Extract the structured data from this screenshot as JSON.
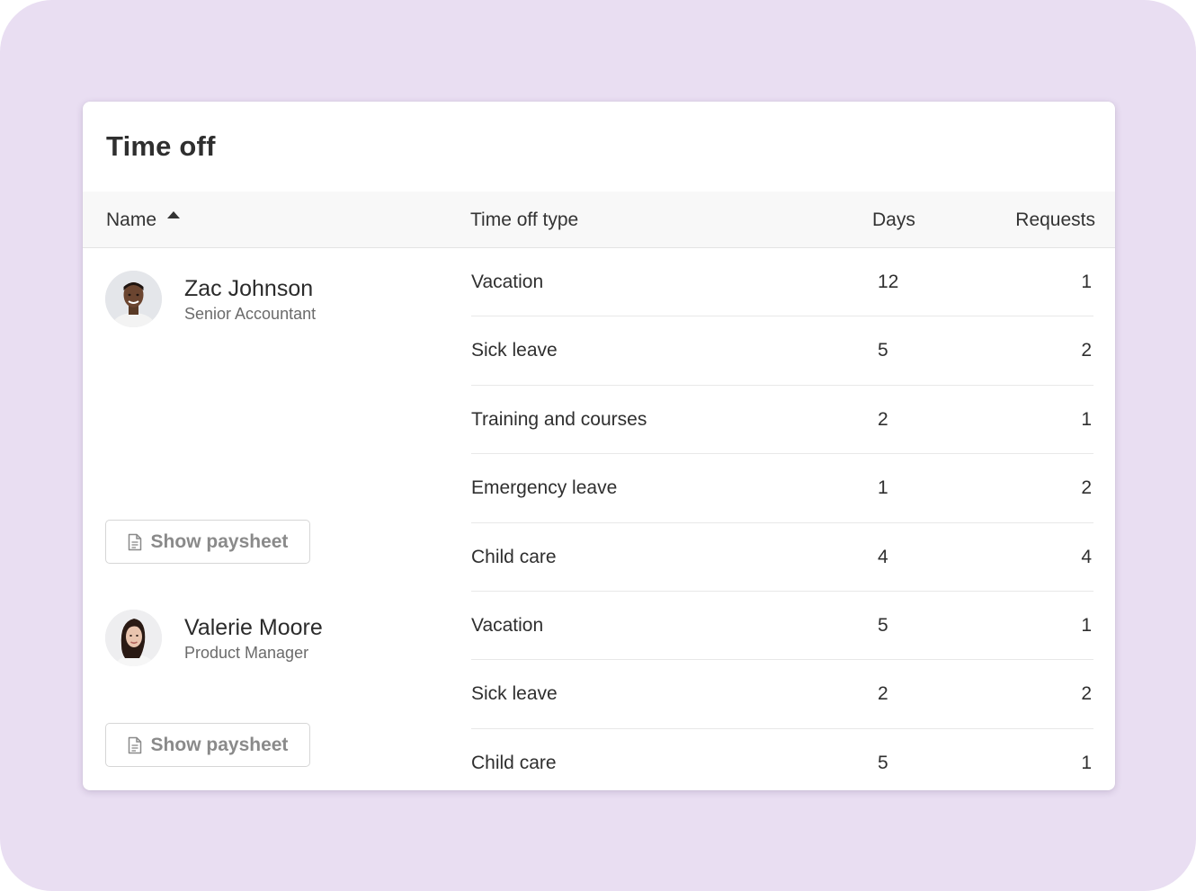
{
  "title": "Time off",
  "columns": {
    "name": "Name",
    "type": "Time off type",
    "days": "Days",
    "requests": "Requests"
  },
  "employees": [
    {
      "name": "Zac Johnson",
      "role": "Senior Accountant",
      "button": "Show paysheet"
    },
    {
      "name": "Valerie Moore",
      "role": "Product Manager",
      "button": "Show paysheet"
    }
  ],
  "rows": [
    {
      "type": "Vacation",
      "days": "12",
      "requests": "1"
    },
    {
      "type": "Sick leave",
      "days": "5",
      "requests": "2"
    },
    {
      "type": "Training and courses",
      "days": "2",
      "requests": "1"
    },
    {
      "type": "Emergency leave",
      "days": "1",
      "requests": "2"
    },
    {
      "type": "Child care",
      "days": "4",
      "requests": "4"
    },
    {
      "type": "Vacation",
      "days": "5",
      "requests": "1"
    },
    {
      "type": "Sick leave",
      "days": "2",
      "requests": "2"
    },
    {
      "type": "Child care",
      "days": "5",
      "requests": "1"
    }
  ],
  "icons": {
    "sort": "sort-ascending-icon",
    "paysheet": "document-icon"
  },
  "colors": {
    "backdrop": "#e9def2",
    "card": "#ffffff",
    "header_row": "#f8f8f8"
  }
}
